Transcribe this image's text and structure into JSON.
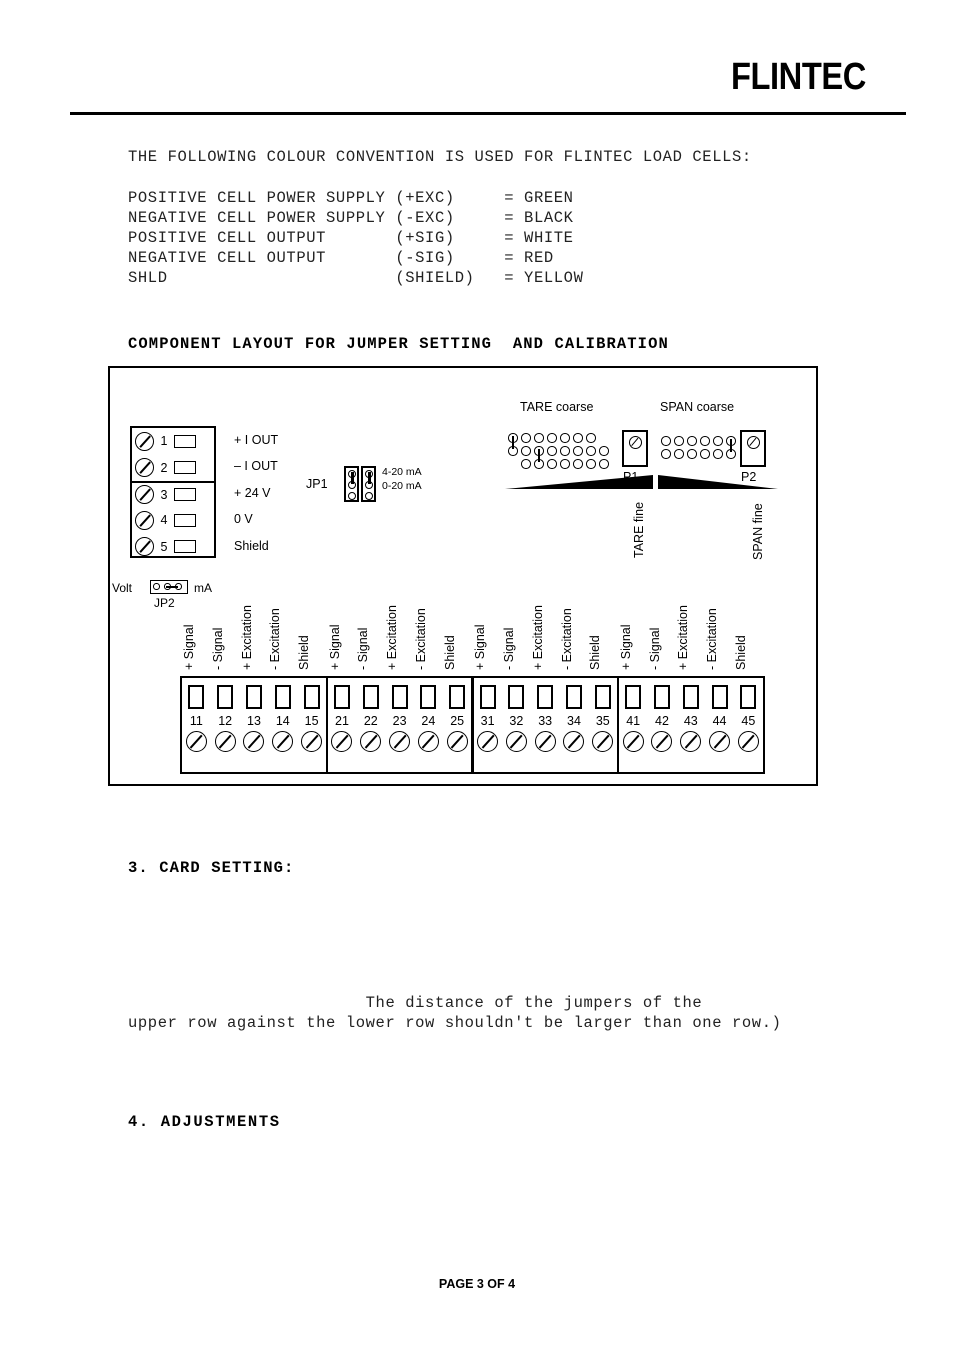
{
  "header": {
    "brand": "FLINTEC"
  },
  "document": {
    "intro_line": "THE FOLLOWING COLOUR CONVENTION IS USED FOR FLINTEC LOAD CELLS:",
    "colour_convention": [
      "POSITIVE CELL POWER SUPPLY (+EXC)     = GREEN",
      "NEGATIVE CELL POWER SUPPLY (-EXC)     = BLACK",
      "POSITIVE CELL OUTPUT       (+SIG)     = WHITE",
      "NEGATIVE CELL OUTPUT       (-SIG)     = RED",
      "SHLD                       (SHIELD)   = YELLOW"
    ],
    "layout_heading": "COMPONENT LAYOUT FOR JUMPER SETTING  AND CALIBRATION",
    "card_setting_heading": "3. CARD SETTING:",
    "card_setting_body": "                        The distance of the jumpers of the\nupper row against the lower row shouldn't be larger than one row.)",
    "adjustments_heading": "4. ADJUSTMENTS",
    "footer": "PAGE 3 OF 4"
  },
  "diagram": {
    "power_block": {
      "rows": [
        {
          "number": "1",
          "name": "+ I OUT"
        },
        {
          "number": "2",
          "name": "– I OUT"
        },
        {
          "number": "3",
          "name": "+ 24 V"
        },
        {
          "number": "4",
          "name": "0 V"
        },
        {
          "number": "5",
          "name": "Shield"
        }
      ]
    },
    "jp2": {
      "left_label": "Volt",
      "right_label": "mA",
      "name": "JP2"
    },
    "jp1": {
      "name": "JP1",
      "option_top": "4-20 mA",
      "option_bottom": "0-20 mA"
    },
    "tare": {
      "coarse_label": "TARE coarse",
      "fine_label": "TARE fine",
      "pot_label": "P1"
    },
    "span": {
      "coarse_label": "SPAN coarse",
      "fine_label": "SPAN fine",
      "pot_label": "P2"
    },
    "terminal_strip": {
      "signal_names": [
        "+ Signal",
        "- Signal",
        "+ Excitation",
        "- Excitation",
        "Shield"
      ],
      "groups": [
        {
          "numbers": [
            "11",
            "12",
            "13",
            "14",
            "15"
          ]
        },
        {
          "numbers": [
            "21",
            "22",
            "23",
            "24",
            "25"
          ]
        },
        {
          "numbers": [
            "31",
            "32",
            "33",
            "34",
            "35"
          ]
        },
        {
          "numbers": [
            "41",
            "42",
            "43",
            "44",
            "45"
          ]
        }
      ]
    }
  }
}
